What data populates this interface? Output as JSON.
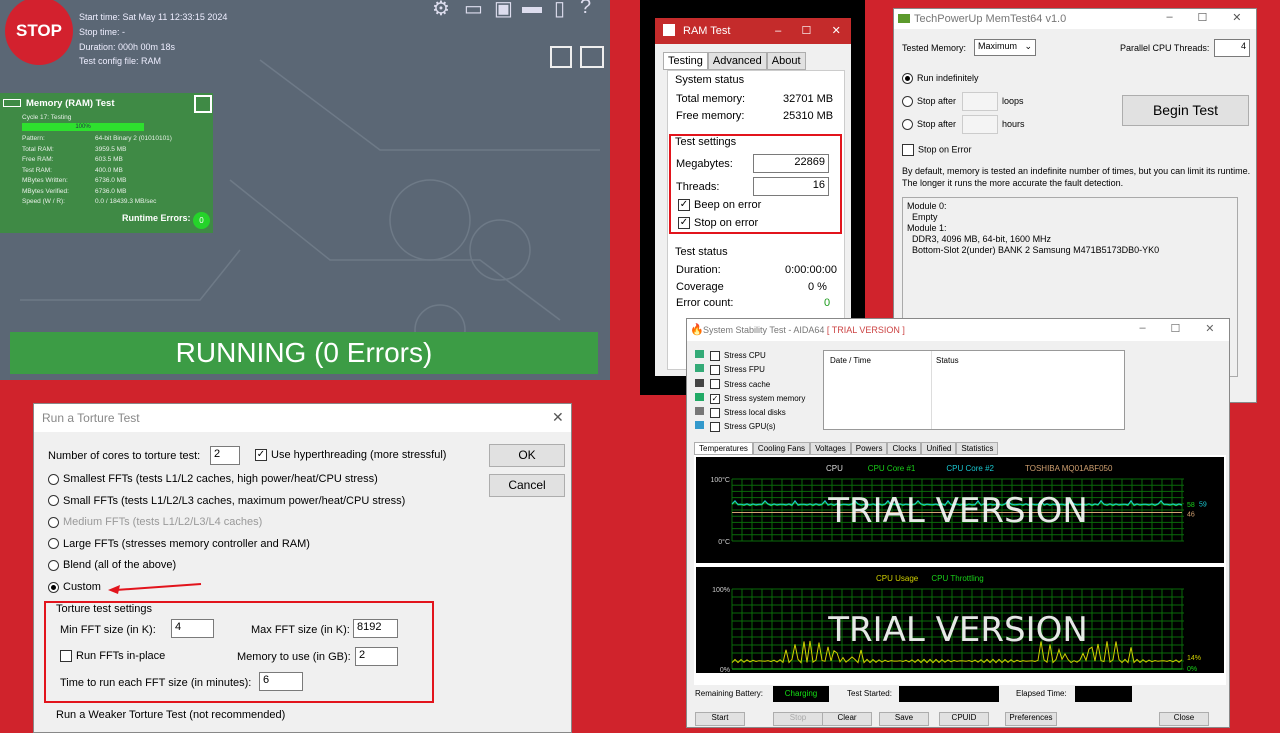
{
  "hci": {
    "stop_label": "STOP",
    "start_time": "Start time: Sat May 11 12:33:15 2024",
    "stop_time": "Stop time: -",
    "duration": "Duration: 000h 00m 18s",
    "config": "Test config file: RAM",
    "card": {
      "title": "Memory (RAM) Test",
      "cycle": "Cycle 17: Testing",
      "progress_label": "100%",
      "progress": 100,
      "rows": [
        {
          "k": "Pattern:",
          "v": "64-bit Binary 2 (01010101)"
        },
        {
          "k": "Total RAM:",
          "v": "3959.5 MB"
        },
        {
          "k": "Free RAM:",
          "v": "603.5 MB"
        },
        {
          "k": "Test RAM:",
          "v": "400.0 MB"
        },
        {
          "k": "MBytes Written:",
          "v": "6736.0 MB"
        },
        {
          "k": "MBytes Verified:",
          "v": "6736.0 MB"
        },
        {
          "k": "Speed (W / R):",
          "v": "0.0 / 18439.3  MB/sec"
        }
      ],
      "errors_label": "Runtime Errors:",
      "errors": "0"
    },
    "status": "RUNNING (0 Errors)",
    "icons": [
      "gear-icon",
      "monitor-icon",
      "save-icon",
      "printer-icon",
      "phone-icon",
      "help-icon"
    ]
  },
  "ramtest": {
    "title": "RAM Test",
    "tabs": [
      "Testing",
      "Advanced",
      "About"
    ],
    "sys_group": "System status",
    "total_label": "Total memory:",
    "total": "32701 MB",
    "free_label": "Free memory:",
    "free": "25310 MB",
    "settings_group": "Test settings",
    "mb_label": "Megabytes:",
    "mb": "22869",
    "threads_label": "Threads:",
    "threads": "16",
    "beep": "Beep on error",
    "stop": "Stop on error",
    "status_group": "Test status",
    "duration_label": "Duration:",
    "duration": "0:00:00:00",
    "coverage_label": "Coverage",
    "coverage": "0 %",
    "errors_label": "Error count:",
    "errors": "0"
  },
  "memtest64": {
    "title": "TechPowerUp MemTest64 v1.0",
    "tested_label": "Tested Memory:",
    "tested": "Maximum",
    "threads_label": "Parallel CPU Threads:",
    "threads": "4",
    "run_indef": "Run indefinitely",
    "stop_after": "Stop after",
    "loops": "loops",
    "hours": "hours",
    "begin": "Begin Test",
    "stop_on_error": "Stop on Error",
    "desc": "By default, memory is tested an indefinite number of times, but you can limit its runtime. The longer it runs the more accurate the fault detection.",
    "modules": [
      "Module 0:",
      "  Empty",
      "Module 1:",
      "  DDR3, 4096 MB, 64-bit, 1600 MHz",
      "  Bottom-Slot 2(under) BANK 2 Samsung M471B5173DB0-YK0"
    ]
  },
  "aida": {
    "title": "System Stability Test - AIDA64",
    "trial": "[ TRIAL VERSION ]",
    "stress": [
      {
        "label": "Stress CPU",
        "checked": false
      },
      {
        "label": "Stress FPU",
        "checked": false
      },
      {
        "label": "Stress cache",
        "checked": false
      },
      {
        "label": "Stress system memory",
        "checked": true
      },
      {
        "label": "Stress local disks",
        "checked": false
      },
      {
        "label": "Stress GPU(s)",
        "checked": false
      }
    ],
    "log_cols": [
      "Date / Time",
      "Status"
    ],
    "tabs": [
      "Temperatures",
      "Cooling Fans",
      "Voltages",
      "Powers",
      "Clocks",
      "Unified",
      "Statistics"
    ],
    "watermark": "TRIAL VERSION",
    "battery_label": "Remaining Battery:",
    "battery": "Charging",
    "started_label": "Test Started:",
    "elapsed_label": "Elapsed Time:",
    "buttons": [
      "Start",
      "Stop",
      "Clear",
      "Save",
      "CPUID",
      "Preferences",
      "Close"
    ]
  },
  "chart_data": [
    {
      "type": "line",
      "legend": [
        {
          "name": "CPU",
          "color": "#ffffff"
        },
        {
          "name": "CPU Core #1",
          "color": "#19d019"
        },
        {
          "name": "CPU Core #2",
          "color": "#19c8d0"
        },
        {
          "name": "TOSHIBA MQ01ABF050",
          "color": "#d0a070"
        }
      ],
      "ylim": [
        0,
        100
      ],
      "ytick_labels": [
        "100°C",
        "0°C"
      ],
      "current_values": [
        {
          "series": "CPU Core #1",
          "value": 58
        },
        {
          "series": "CPU Core #2",
          "value": 59
        },
        {
          "series": "TOSHIBA MQ01ABF050",
          "value": 46
        }
      ],
      "grid": true
    },
    {
      "type": "line",
      "legend": [
        {
          "name": "CPU Usage",
          "color": "#d0d000"
        },
        {
          "name": "CPU Throttling",
          "color": "#19d019"
        }
      ],
      "ylim": [
        0,
        100
      ],
      "ytick_labels": [
        "100%",
        "0%"
      ],
      "current_values": [
        {
          "series": "CPU Usage",
          "value": 14,
          "label": "14%"
        },
        {
          "series": "CPU Throttling",
          "value": 0,
          "label": "0%"
        }
      ],
      "grid": true
    }
  ],
  "torture": {
    "title": "Run a Torture Test",
    "cores_label": "Number of cores to torture test:",
    "cores": "2",
    "hyper": "Use hyperthreading (more stressful)",
    "ok": "OK",
    "cancel": "Cancel",
    "options": [
      {
        "label": "Smallest FFTs (tests L1/L2 caches, high power/heat/CPU stress)",
        "disabled": false
      },
      {
        "label": "Small FFTs (tests L1/L2/L3 caches, maximum power/heat/CPU stress)",
        "disabled": false
      },
      {
        "label": "Medium FFTs (tests L1/L2/L3/L4 caches)",
        "disabled": true
      },
      {
        "label": "Large FFTs (stresses memory controller and RAM)",
        "disabled": false
      },
      {
        "label": "Blend (all of the above)",
        "disabled": false
      },
      {
        "label": "Custom",
        "disabled": false,
        "selected": true
      }
    ],
    "settings_group": "Torture test settings",
    "min_label": "Min FFT size (in K):",
    "min": "4",
    "max_label": "Max FFT size (in K):",
    "max": "8192",
    "inplace": "Run FFTs in-place",
    "mem_label": "Memory to use (in GB):",
    "mem": "2",
    "time_label": "Time to run each FFT size (in minutes):",
    "time": "6",
    "weaker": "Run a Weaker Torture Test (not recommended)"
  },
  "colors": {
    "background": "#d0232c",
    "highlight": "#e2141c",
    "hci_green": "#3c9c45"
  }
}
